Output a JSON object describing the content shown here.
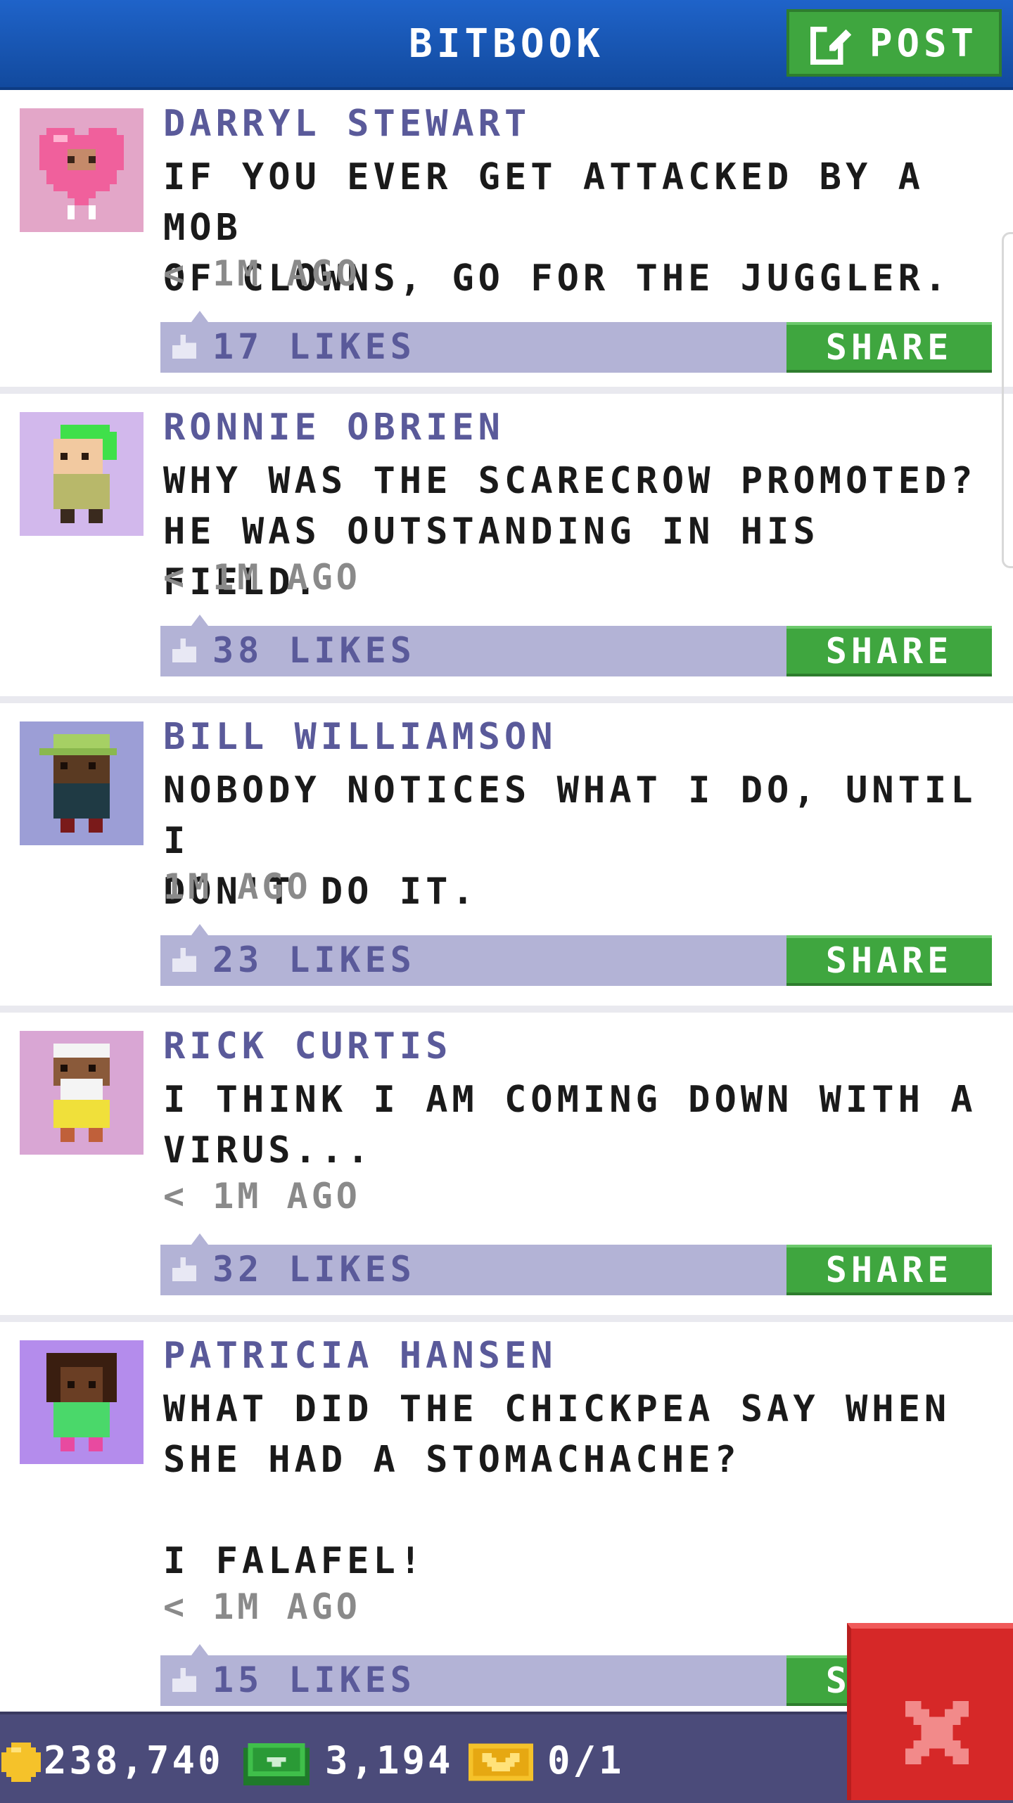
{
  "header": {
    "title": "BITBOOK",
    "post_label": "POST"
  },
  "posts": [
    {
      "author": "DARRYL STEWART",
      "text": "IF YOU EVER GET ATTACKED BY A MOB\nOF CLOWNS, GO FOR THE JUGGLER.",
      "time": "< 1M AGO",
      "likes": "17 LIKES",
      "share": "SHARE",
      "avatar_bg": "#e3a6c8"
    },
    {
      "author": "RONNIE OBRIEN",
      "text": "WHY WAS THE SCARECROW PROMOTED?\nHE WAS OUTSTANDING IN HIS FIELD.",
      "time": "< 1M AGO",
      "likes": "38 LIKES",
      "share": "SHARE",
      "avatar_bg": "#d2b8ec"
    },
    {
      "author": "BILL WILLIAMSON",
      "text": "NOBODY NOTICES WHAT I DO, UNTIL I\nDON'T DO IT.",
      "time": "1M AGO",
      "likes": "23 LIKES",
      "share": "SHARE",
      "avatar_bg": "#9c9ed6"
    },
    {
      "author": "RICK CURTIS",
      "text": "I THINK I AM COMING DOWN WITH A\nVIRUS...",
      "time": "< 1M AGO",
      "likes": "32 LIKES",
      "share": "SHARE",
      "avatar_bg": "#d9a6d4"
    },
    {
      "author": "PATRICIA HANSEN",
      "text": "WHAT DID THE CHICKPEA SAY WHEN\nSHE HAD A STOMACHACHE?\n\nI FALAFEL!",
      "time": "< 1M AGO",
      "likes": "15 LIKES",
      "share": "SHARE",
      "avatar_bg": "#b48cec"
    }
  ],
  "footer": {
    "coins": "238,740",
    "cash": "3,194",
    "tickets": "0/1"
  },
  "colors": {
    "header_blue": "#1a56b8",
    "post_green": "#3fa63f",
    "likes_bar": "#b3b3d6",
    "author_purple": "#5a5a9a",
    "close_red": "#d62828",
    "footer_bg": "#4b4b7a"
  },
  "icons": {
    "post": "edit-icon",
    "like": "thumbs-up-icon",
    "coin": "coin-icon",
    "cash": "cash-icon",
    "ticket": "ticket-icon",
    "close": "close-icon"
  }
}
